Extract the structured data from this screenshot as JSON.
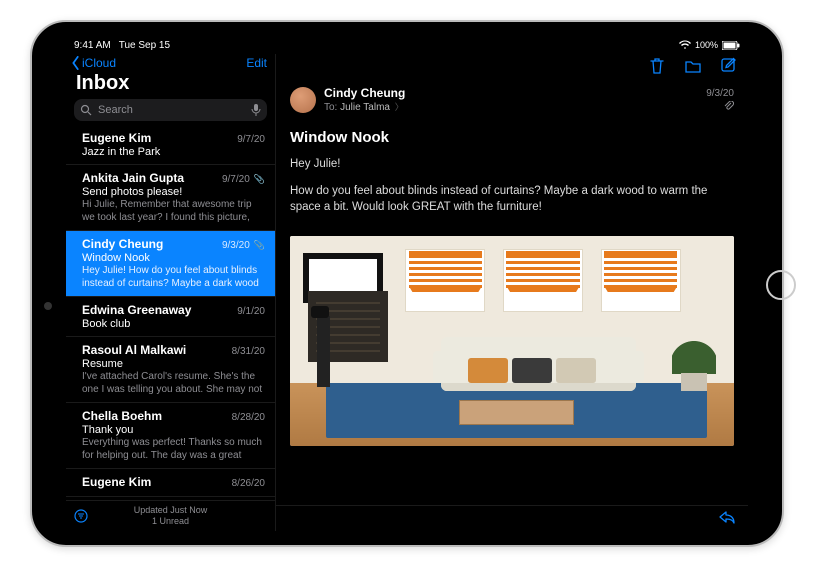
{
  "status": {
    "time": "9:41 AM",
    "date": "Tue Sep 15"
  },
  "nav": {
    "back": "iCloud",
    "edit": "Edit"
  },
  "title": "Inbox",
  "search": {
    "placeholder": "Search"
  },
  "messages": [
    {
      "sender": "Eugene Kim",
      "date": "9/7/20",
      "subject": "Jazz in the Park",
      "preview": "",
      "attachment": false,
      "selected": false
    },
    {
      "sender": "Ankita Jain Gupta",
      "date": "9/7/20",
      "subject": "Send photos please!",
      "preview": "Hi Julie, Remember that awesome trip we took last year? I found this picture, and th…",
      "attachment": true,
      "selected": false
    },
    {
      "sender": "Cindy Cheung",
      "date": "9/3/20",
      "subject": "Window Nook",
      "preview": "Hey Julie! How do you feel about blinds instead of curtains? Maybe a dark wood to…",
      "attachment": true,
      "selected": true
    },
    {
      "sender": "Edwina Greenaway",
      "date": "9/1/20",
      "subject": "Book club",
      "preview": "",
      "attachment": false,
      "selected": false
    },
    {
      "sender": "Rasoul Al Malkawi",
      "date": "8/31/20",
      "subject": "Resume",
      "preview": "I've attached Carol's resume. She's the one I was telling you about. She may not have…",
      "attachment": false,
      "selected": false
    },
    {
      "sender": "Chella Boehm",
      "date": "8/28/20",
      "subject": "Thank you",
      "preview": "Everything was perfect! Thanks so much for helping out. The day was a great success,…",
      "attachment": false,
      "selected": false
    },
    {
      "sender": "Eugene Kim",
      "date": "8/26/20",
      "subject": "",
      "preview": "",
      "attachment": false,
      "selected": false
    }
  ],
  "footer": {
    "status": "Updated Just Now",
    "sub": "1 Unread"
  },
  "detail": {
    "from": "Cindy Cheung",
    "to_label": "To:",
    "to": "Julie Talma",
    "date": "9/3/20",
    "subject": "Window Nook",
    "greeting": "Hey Julie!",
    "body": "How do you feel about blinds instead of curtains? Maybe a dark wood to warm the space a bit. Would look GREAT with the furniture!"
  }
}
